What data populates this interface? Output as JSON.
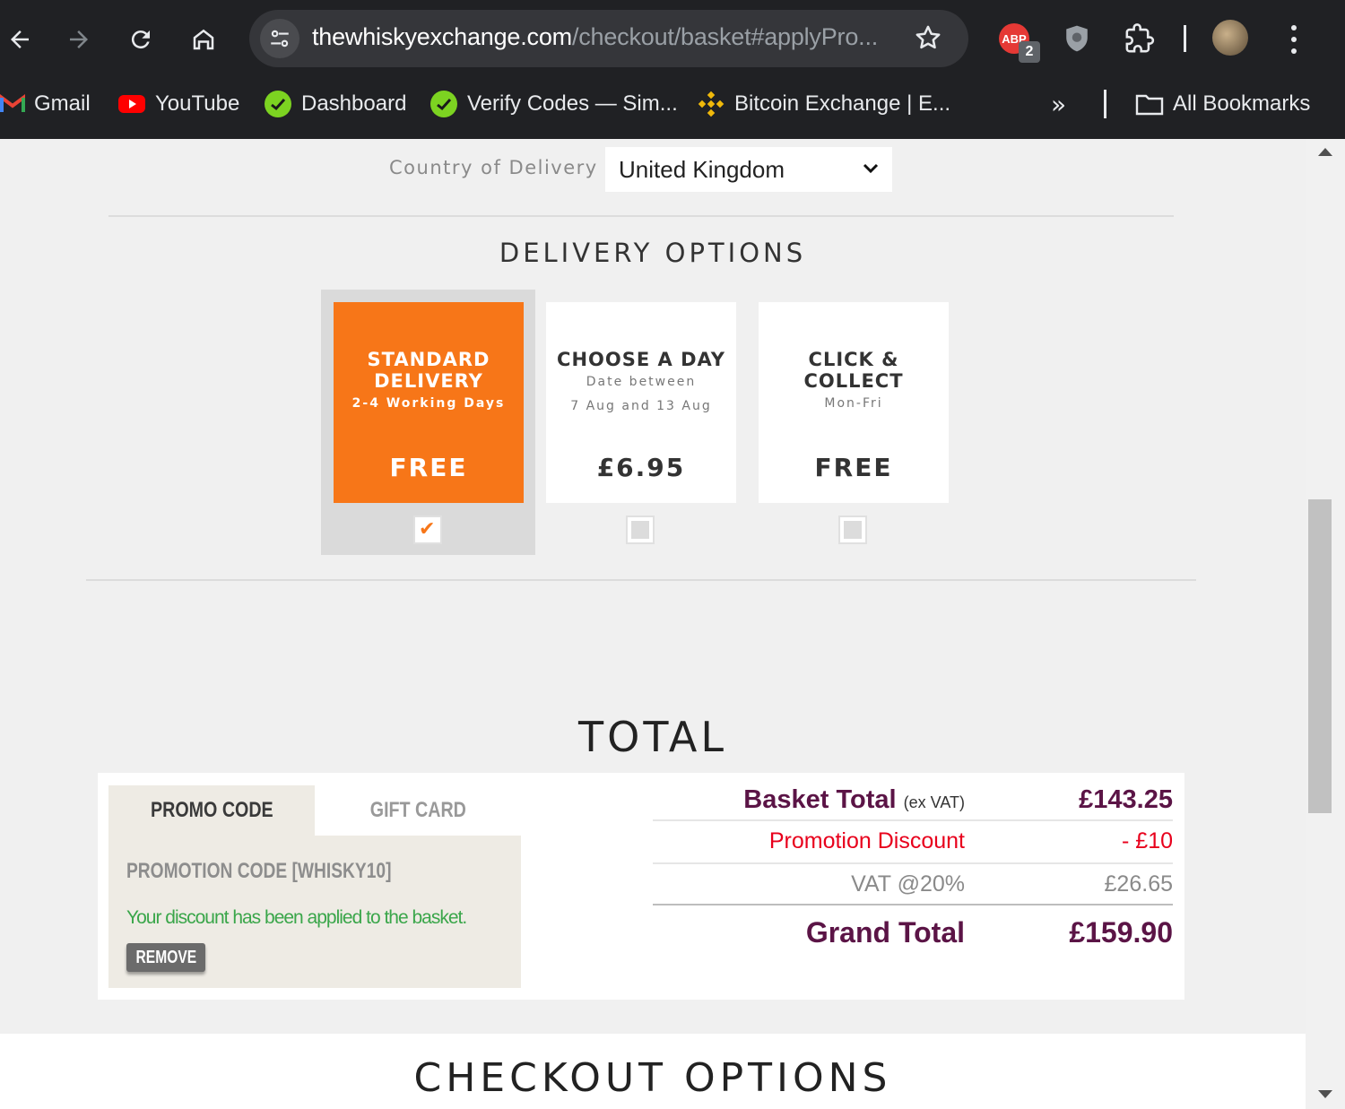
{
  "browser": {
    "url_host": "thewhiskyexchange.com",
    "url_path": "/checkout/basket#applyPro...",
    "extension_badge": "ABP",
    "extension_badge_count": "2",
    "bookmarks": [
      {
        "label": "Gmail",
        "icon": "gmail-icon"
      },
      {
        "label": "YouTube",
        "icon": "youtube-icon"
      },
      {
        "label": "Dashboard",
        "icon": "dashboard-icon"
      },
      {
        "label": "Verify Codes — Sim...",
        "icon": "verify-codes-icon"
      },
      {
        "label": "Bitcoin Exchange | E...",
        "icon": "binance-icon"
      }
    ],
    "bookmarks_overflow": "»",
    "all_bookmarks_label": "All Bookmarks"
  },
  "delivery": {
    "country_label": "Country of Delivery",
    "country_value": "United Kingdom",
    "title": "DELIVERY OPTIONS",
    "options": [
      {
        "title_line1": "STANDARD",
        "title_line2": "DELIVERY",
        "sub1": "2-4 Working Days",
        "sub2": "",
        "price": "FREE",
        "selected": true
      },
      {
        "title_line1": "CHOOSE A DAY",
        "title_line2": "",
        "sub1": "Date between",
        "sub2": "7 Aug and 13 Aug",
        "price": "£6.95",
        "selected": false
      },
      {
        "title_line1": "CLICK &",
        "title_line2": "COLLECT",
        "sub1": "Mon-Fri",
        "sub2": "",
        "price": "FREE",
        "selected": false
      }
    ]
  },
  "total": {
    "title": "TOTAL",
    "tabs": [
      "PROMO CODE",
      "GIFT CARD"
    ],
    "promo_code_text": "PROMOTION CODE [WHISKY10]",
    "promo_message": "Your discount has been applied to the basket.",
    "remove_label": "REMOVE",
    "basket_total_label": "Basket Total",
    "basket_total_suffix": "(ex VAT)",
    "basket_total_value": "£143.25",
    "promotion_discount_label": "Promotion Discount",
    "promotion_discount_value": "- £10",
    "vat_label": "VAT @20%",
    "vat_value": "£26.65",
    "grand_total_label": "Grand Total",
    "grand_total_value": "£159.90"
  },
  "checkout": {
    "title": "CHECKOUT OPTIONS"
  },
  "colors": {
    "accent_orange": "#f77618",
    "brand_plum": "#5b1446",
    "discount_red": "#e8001c",
    "success_green": "#3aa64a"
  }
}
